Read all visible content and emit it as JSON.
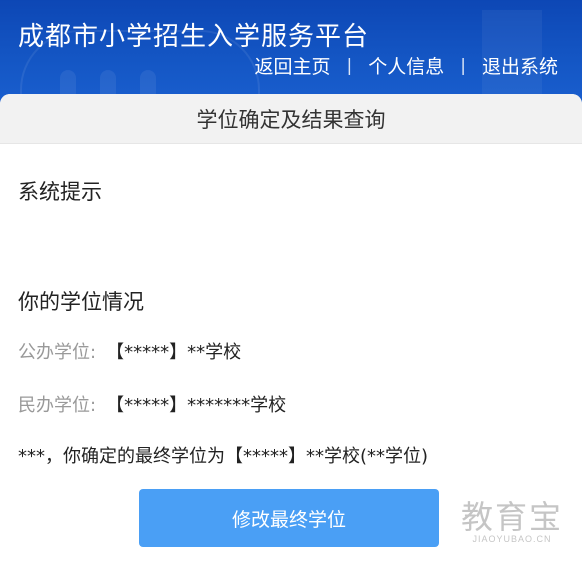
{
  "header": {
    "title": "成都市小学招生入学服务平台",
    "nav": [
      {
        "label": "返回主页"
      },
      {
        "label": "个人信息"
      },
      {
        "label": "退出系统"
      }
    ],
    "separator": "|",
    "background_color": "#1456c4"
  },
  "card": {
    "title": "学位确定及结果查询",
    "system_tip_title": "系统提示",
    "placement_title": "你的学位情况",
    "public_label": "公办学位:",
    "public_value": "【*****】**学校",
    "private_label": "民办学位:",
    "private_value": "【*****】*******学校",
    "final_statement": "***，你确定的最终学位为【*****】**学校(**学位)",
    "modify_button": "修改最终学位",
    "button_color": "#4a9ff5"
  },
  "watermark": {
    "main": "教育宝",
    "sub": "JIAOYUBAO.CN"
  }
}
